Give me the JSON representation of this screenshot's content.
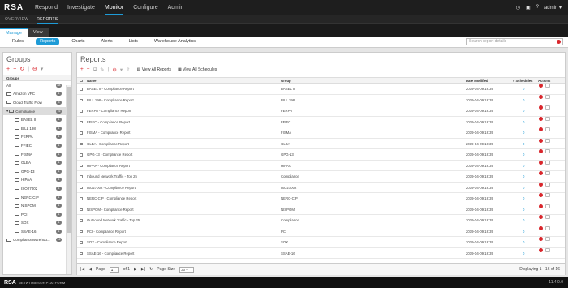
{
  "topbar": {
    "logo": "RSA",
    "nav": [
      "Respond",
      "Investigate",
      "Monitor",
      "Configure",
      "Admin"
    ],
    "active": "Monitor",
    "user": "admin"
  },
  "subnav": {
    "items": [
      "OVERVIEW",
      "REPORTS"
    ],
    "active": "REPORTS"
  },
  "mode_tabs": [
    "Manage",
    "View"
  ],
  "filters": {
    "items": [
      "Rules",
      "Reports",
      "Charts",
      "Alerts",
      "Lists",
      "Warehouse Analytics"
    ],
    "active": "Reports",
    "search_placeholder": "Search report details"
  },
  "groups": {
    "title": "Groups",
    "header": "Groups",
    "items": [
      {
        "label": "All",
        "count": "88",
        "level": 0,
        "folder": false
      },
      {
        "label": "Amazon VPC",
        "count": "1",
        "level": 0,
        "folder": true
      },
      {
        "label": "Cloud Traffic Flow",
        "count": "3",
        "level": 0,
        "folder": true
      },
      {
        "label": "Compliance",
        "count": "16",
        "level": 0,
        "folder": true,
        "selected": true,
        "expanded": true
      },
      {
        "label": "BASEL II",
        "count": "1",
        "level": 1,
        "folder": true
      },
      {
        "label": "BILL 198",
        "count": "1",
        "level": 1,
        "folder": true
      },
      {
        "label": "FERPA",
        "count": "1",
        "level": 1,
        "folder": true
      },
      {
        "label": "FFIEC",
        "count": "1",
        "level": 1,
        "folder": true
      },
      {
        "label": "FISMA",
        "count": "1",
        "level": 1,
        "folder": true
      },
      {
        "label": "GLBA",
        "count": "1",
        "level": 1,
        "folder": true
      },
      {
        "label": "GPG-13",
        "count": "1",
        "level": 1,
        "folder": true
      },
      {
        "label": "HIPAA",
        "count": "1",
        "level": 1,
        "folder": true
      },
      {
        "label": "ISO27002",
        "count": "1",
        "level": 1,
        "folder": true
      },
      {
        "label": "NERC-CIP",
        "count": "1",
        "level": 1,
        "folder": true
      },
      {
        "label": "NISPOM",
        "count": "1",
        "level": 1,
        "folder": true
      },
      {
        "label": "PCI",
        "count": "1",
        "level": 1,
        "folder": true
      },
      {
        "label": "SOX",
        "count": "1",
        "level": 1,
        "folder": true
      },
      {
        "label": "SSAE-16",
        "count": "1",
        "level": 1,
        "folder": true
      },
      {
        "label": "ComplianceWarehou...",
        "count": "16",
        "level": 0,
        "folder": true
      }
    ]
  },
  "reports": {
    "title": "Reports",
    "view_all_reports": "View All Reports",
    "view_all_schedules": "View All Schedules",
    "columns": {
      "name": "Name",
      "group": "Group",
      "date": "Date Modified",
      "schedules": "# Schedules",
      "actions": "Actions"
    },
    "rows": [
      {
        "name": "BASEL II - Compliance Report",
        "group": "BASEL II",
        "date": "2019-04-09 18:39",
        "schedules": "0"
      },
      {
        "name": "BILL 198 - Compliance Report",
        "group": "BILL 198",
        "date": "2019-04-09 18:39",
        "schedules": "0"
      },
      {
        "name": "FERPA - Compliance Report",
        "group": "FERPA",
        "date": "2019-04-09 18:39",
        "schedules": "0"
      },
      {
        "name": "FFIEC - Compliance Report",
        "group": "FFIEC",
        "date": "2019-04-09 18:39",
        "schedules": "0"
      },
      {
        "name": "FISMA - Compliance Report",
        "group": "FISMA",
        "date": "2019-04-09 18:39",
        "schedules": "0"
      },
      {
        "name": "GLBA - Compliance Report",
        "group": "GLBA",
        "date": "2019-04-09 18:39",
        "schedules": "0"
      },
      {
        "name": "GPG-13 - Compliance Report",
        "group": "GPG-13",
        "date": "2019-04-09 18:39",
        "schedules": "0"
      },
      {
        "name": "HIPAA - Compliance Report",
        "group": "HIPAA",
        "date": "2019-04-09 18:39",
        "schedules": "0"
      },
      {
        "name": "Inbound Network Traffic - Top 25",
        "group": "Compliance",
        "date": "2019-04-09 18:39",
        "schedules": "0"
      },
      {
        "name": "ISO27002 - Compliance Report",
        "group": "ISO27002",
        "date": "2019-04-09 18:39",
        "schedules": "0"
      },
      {
        "name": "NERC-CIP - Compliance Report",
        "group": "NERC-CIP",
        "date": "2019-04-09 18:39",
        "schedules": "0"
      },
      {
        "name": "NISPOM - Compliance Report",
        "group": "NISPOM",
        "date": "2019-04-09 18:39",
        "schedules": "0"
      },
      {
        "name": "Outbound Network Traffic - Top 25",
        "group": "Compliance",
        "date": "2019-04-09 18:39",
        "schedules": "0"
      },
      {
        "name": "PCI - Compliance Report",
        "group": "PCI",
        "date": "2019-04-09 18:39",
        "schedules": "0"
      },
      {
        "name": "SOX - Compliance Report",
        "group": "SOX",
        "date": "2019-04-09 18:39",
        "schedules": "0"
      },
      {
        "name": "SSAE-16 - Compliance Report",
        "group": "SSAE-16",
        "date": "2019-04-09 18:39",
        "schedules": "0"
      }
    ],
    "pager": {
      "page_label": "Page",
      "page": "1",
      "of_label": "of 1",
      "page_size_label": "Page Size",
      "page_size": "30",
      "displaying": "Displaying 1 - 16 of 16"
    }
  },
  "footer": {
    "logo": "RSA",
    "product": "NETWITNESS® PLATFORM",
    "version": "11.4.0.0"
  },
  "colors": {
    "accent": "#1e9bd7",
    "danger": "#d9262c"
  }
}
